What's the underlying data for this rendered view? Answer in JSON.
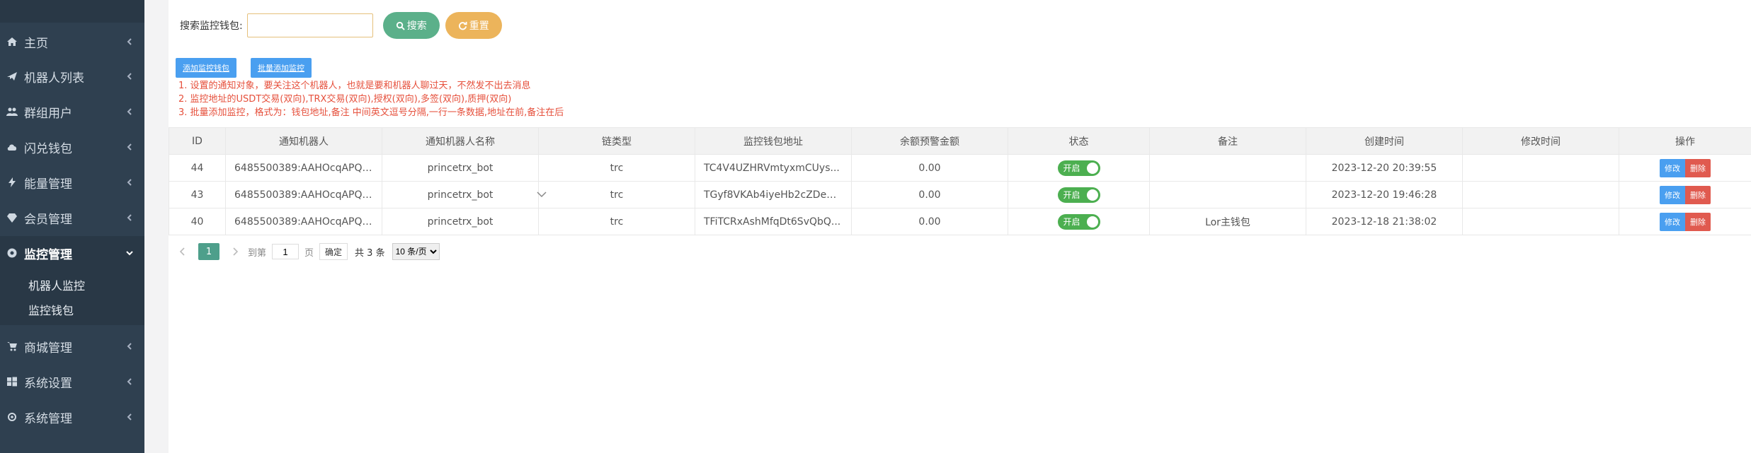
{
  "sidebar": {
    "items": [
      {
        "label": "主页",
        "icon": "home-icon"
      },
      {
        "label": "机器人列表",
        "icon": "plane-icon"
      },
      {
        "label": "群组用户",
        "icon": "users-icon"
      },
      {
        "label": "闪兑钱包",
        "icon": "cloud-icon"
      },
      {
        "label": "能量管理",
        "icon": "bolt-icon"
      },
      {
        "label": "会员管理",
        "icon": "diamond-icon"
      },
      {
        "label": "监控管理",
        "icon": "eye-icon"
      },
      {
        "label": "商城管理",
        "icon": "cart-icon"
      },
      {
        "label": "系统设置",
        "icon": "windows-icon"
      },
      {
        "label": "系统管理",
        "icon": "gear-icon"
      }
    ],
    "submenu": [
      "机器人监控",
      "监控钱包"
    ]
  },
  "search": {
    "label": "搜索监控钱包:",
    "placeholder": "",
    "search_button": "搜索",
    "reset_button": "重置"
  },
  "actions": {
    "add": "添加监控钱包",
    "batch_add": "批量添加监控"
  },
  "notes": [
    "1. 设置的通知对象，要关注这个机器人，也就是要和机器人聊过天，不然发不出去消息",
    "2. 监控地址的USDT交易(双向),TRX交易(双向),授权(双向),多签(双向),质押(双向)",
    "3. 批量添加监控，格式为：钱包地址,备注 中间英文逗号分隔,一行一条数据,地址在前,备注在后"
  ],
  "table": {
    "headers": [
      "ID",
      "通知机器人",
      "通知机器人名称",
      "链类型",
      "监控钱包地址",
      "余额预警金额",
      "状态",
      "备注",
      "创建时间",
      "修改时间",
      "操作"
    ],
    "rows": [
      {
        "id": "44",
        "bot": "6485500389:AAHOcqAPQu...",
        "bot_name": "princetrx_bot",
        "chain": "trc",
        "address": "TC4V4UZHRVmtyxmCUys...",
        "balance": "0.00",
        "status": "开启",
        "remark": "",
        "created": "2023-12-20 20:39:55",
        "modified": ""
      },
      {
        "id": "43",
        "bot": "6485500389:AAHOcqAPQu...",
        "bot_name": "princetrx_bot",
        "chain": "trc",
        "address": "TGyf8VKAb4iyeHb2cZDe2u...",
        "balance": "0.00",
        "status": "开启",
        "remark": "",
        "created": "2023-12-20 19:46:28",
        "modified": ""
      },
      {
        "id": "40",
        "bot": "6485500389:AAHOcqAPQu...",
        "bot_name": "princetrx_bot",
        "chain": "trc",
        "address": "TFiTCRxAshMfqDt6SvQbQ...",
        "balance": "0.00",
        "status": "开启",
        "remark": "Lor主钱包",
        "created": "2023-12-18 21:38:02",
        "modified": ""
      }
    ],
    "edit_label": "修改",
    "delete_label": "删除"
  },
  "pager": {
    "current": "1",
    "goto_label": "到第",
    "goto_value": "1",
    "page_unit": "页",
    "confirm": "确定",
    "total": "共 3 条",
    "page_size": "10 条/页"
  },
  "colors": {
    "sidebar_bg": "#2f4050",
    "search_button": "#5bb08a",
    "reset_button": "#ecb45b",
    "primary_blue": "#4a9ff0",
    "danger_red": "#e05a4f",
    "notes_red": "#e6503c",
    "toggle_green": "#4caf50"
  }
}
